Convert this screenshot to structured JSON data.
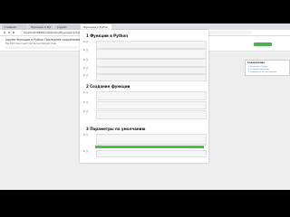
{
  "browser": {
    "tabs": [
      {
        "label": "Главная"
      },
      {
        "label": "Функции в Python"
      },
      {
        "label": "Jupyter"
      },
      {
        "label": "Функции в Python",
        "active": true
      }
    ],
    "address": "localhost:8888/notebooks/Функции в Python.ipynb"
  },
  "jupyter": {
    "title": "jupyter  Функции в Python  Последнее сохранение: несколько минут назад",
    "menu": "File  Edit  View  Insert  Cell  Kernel  Widgets  Help",
    "status": "Python 3"
  },
  "notebook": {
    "sections": [
      {
        "number": "1",
        "title": "Функции в Python"
      },
      {
        "number": "2",
        "title": "Создание функции"
      },
      {
        "number": "3",
        "title": "Параметры по умолчанию"
      }
    ],
    "prompt_label": "In [ ]:"
  },
  "toc": {
    "title": "Содержание",
    "items": [
      "1  Функции в Python",
      "2  Создание функции",
      "3  Параметры по умолчанию"
    ]
  },
  "colors": {
    "selected_cell": "#43c343",
    "status": "#4caf50"
  }
}
